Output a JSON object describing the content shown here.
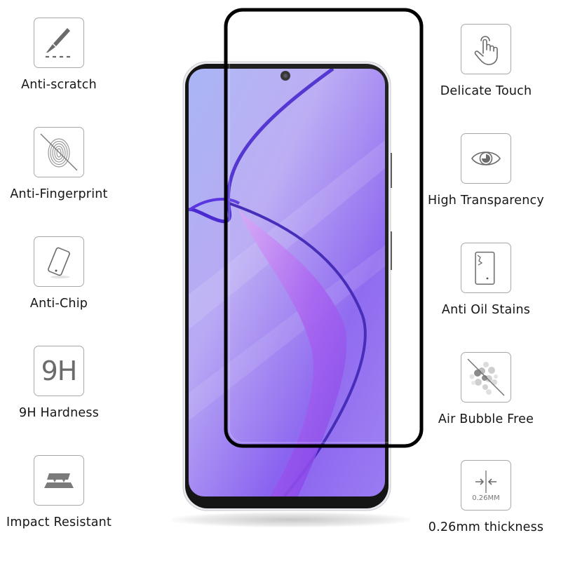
{
  "product": {
    "description": "Full-cover tempered glass screen protector shown over a smartphone with purple wallpaper",
    "colors": {
      "icon_stroke": "#6b6b6b",
      "icon_border": "#a8a8a8",
      "label_text": "#161616",
      "glass_frame": "#000000",
      "screen_purple": "#8a63f0"
    }
  },
  "features_left": [
    {
      "label": "Anti-scratch",
      "icon": "scalpel-scratch-icon"
    },
    {
      "label": "Anti-Fingerprint",
      "icon": "fingerprint-crossed-icon"
    },
    {
      "label": "Anti-Chip",
      "icon": "tilted-phone-icon"
    },
    {
      "label": "9H Hardness",
      "icon": "9h-text-icon",
      "icon_text": "9H"
    },
    {
      "label": "Impact Resistant",
      "icon": "impact-layers-icon"
    }
  ],
  "features_right": [
    {
      "label": "Delicate Touch",
      "icon": "touch-hand-icon"
    },
    {
      "label": "High Transparency",
      "icon": "eye-icon"
    },
    {
      "label": "Anti Oil Stains",
      "icon": "phone-crack-icon"
    },
    {
      "label": "Air Bubble Free",
      "icon": "bubbles-crossed-icon"
    },
    {
      "label": "0.26mm thickness",
      "icon": "thickness-arrows-icon",
      "icon_text": "0.26MM"
    }
  ]
}
